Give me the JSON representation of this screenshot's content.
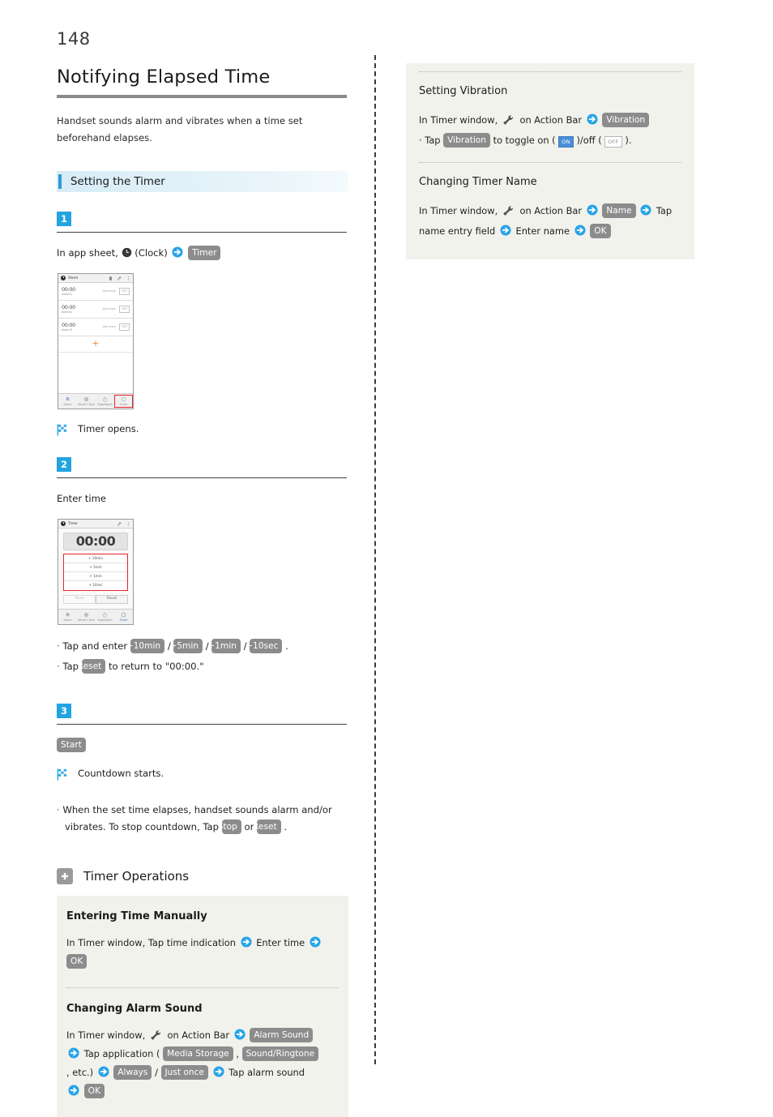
{
  "page": {
    "number": "148"
  },
  "article": {
    "title": "Notifying Elapsed Time",
    "lead": "Handset sounds alarm and vibrates when a time set beforehand elapses."
  },
  "section": {
    "label": "Setting the Timer"
  },
  "steps": [
    {
      "number": "1",
      "text_before": "In app sheet,",
      "clock_label": "(Clock)",
      "chip": "Timer",
      "result": "Timer opens."
    },
    {
      "number": "2",
      "text": "Enter time",
      "bullets": [
        {
          "prefix": "Tap and enter",
          "chips": [
            "+10min",
            "+5min",
            "+1min",
            "+10sec"
          ],
          "suffix": "."
        },
        {
          "prefix": "Tap",
          "chips": [
            "Reset"
          ],
          "suffix": "to return to \"00:00.\""
        }
      ]
    },
    {
      "number": "3",
      "chip": "Start",
      "result": "Countdown starts.",
      "note_part1": "When the set time elapses, handset sounds alarm and/or vibrates. To stop countdown, Tap",
      "note_chip1": "Stop",
      "note_or": "or",
      "note_chip2": "Reset",
      "note_end": "."
    }
  ],
  "phone_alarm": {
    "app_name": "Alarm",
    "icons": [
      "trash-icon",
      "wrench-icon",
      "overflow-icon"
    ],
    "rows": [
      {
        "time": "00:00",
        "name": "Alarm1",
        "repeat": "Just once",
        "toggle": "OFF"
      },
      {
        "time": "00:00",
        "name": "Alarm2",
        "repeat": "Just once",
        "toggle": "OFF"
      },
      {
        "time": "00:00",
        "name": "Alarm3",
        "repeat": "Just once",
        "toggle": "OFF"
      }
    ],
    "add_symbol": "+",
    "nav": [
      "Alarm",
      "World Clock",
      "Stopwatch",
      "Timer"
    ],
    "nav_highlighted": "Timer"
  },
  "phone_timer": {
    "app_name": "Timer",
    "icons": [
      "wrench-icon",
      "overflow-icon"
    ],
    "time_value": "00:00",
    "add_buttons": [
      "+ 10min",
      "+ 5min",
      "+ 1min",
      "+ 10sec"
    ],
    "start_label": "Start",
    "reset_label": "Reset",
    "nav": [
      "Alarm",
      "World Clock",
      "Stopwatch",
      "Timer"
    ],
    "nav_active": "Timer"
  },
  "operations": {
    "title": "Timer Operations",
    "items": [
      {
        "heading": "Entering Time Manually",
        "t1": "In Timer window, Tap time indication",
        "t2": "Enter time",
        "chip_ok": "OK"
      },
      {
        "heading": "Changing Alarm Sound",
        "t1": "In Timer window,",
        "t2": "on Action Bar",
        "chip_alarm_sound": "Alarm Sound",
        "t3": "Tap application (",
        "chip_media": "Media Storage",
        "comma": ",",
        "chip_ringtone": "Sound/Ringtone",
        "t4": ", etc.)",
        "chip_always": "Always",
        "slash": "/",
        "chip_just_once": "Just once",
        "t5": "Tap alarm sound",
        "chip_ok": "OK"
      }
    ]
  },
  "right_column": {
    "items": [
      {
        "heading": "Setting Vibration",
        "t1": "In Timer window,",
        "t2": "on Action Bar",
        "chip_vibration": "Vibration",
        "b1": "Tap",
        "chip_vibration2": "Vibration",
        "b2": "to toggle on (",
        "mini_on": "ON",
        "b3": ")/off (",
        "mini_off": "OFF",
        "b4": ")."
      },
      {
        "heading": "Changing Timer Name",
        "t1": "In Timer window,",
        "t2": "on Action Bar",
        "chip_name": "Name",
        "t3": "Tap name entry field",
        "t4": "Enter name",
        "chip_ok": "OK"
      }
    ]
  },
  "colors": {
    "accent_blue": "#23a3e0",
    "chip_gray": "#8c8c8c",
    "band_blue": "#d7ecf7",
    "box_beige": "#f2f2ec",
    "highlight_red": "#e8242a"
  }
}
